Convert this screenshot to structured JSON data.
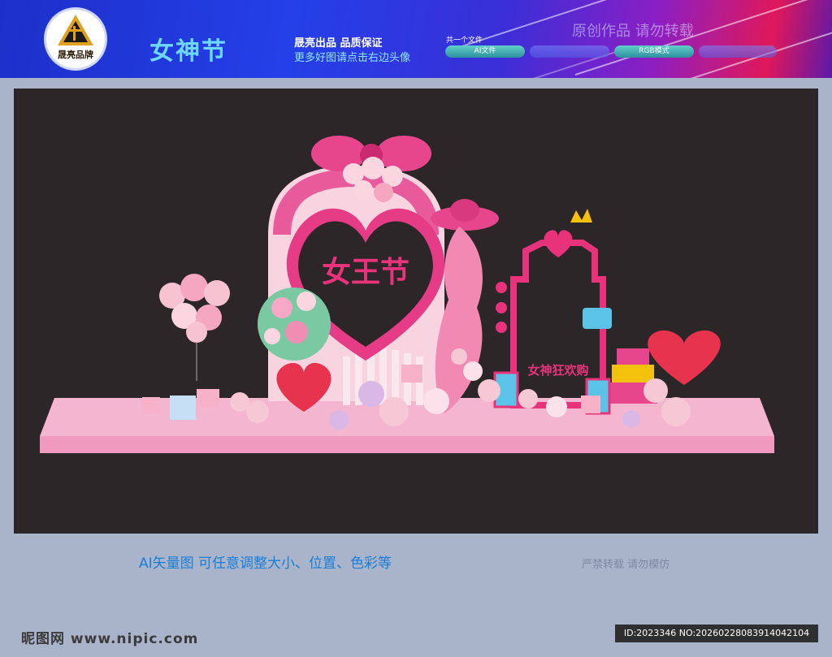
{
  "banner": {
    "logo_text": "晟亮品牌",
    "title": "女神节",
    "brand_line": "晟亮出品  品质保证",
    "sub_line": "更多好图请点击右边头像",
    "file_count": "共一个文件",
    "pill_ai": "AI文件",
    "pill_rgb": "RGB模式",
    "right_text": "原创作品  请勿转载"
  },
  "stage": {
    "heart_text": "女王节",
    "board_text": "女神狂欢购"
  },
  "caption": {
    "left": "AI矢量图  可任意调整大小、位置、色彩等",
    "right": "严禁转载  请勿模仿"
  },
  "footer": {
    "site": "昵图网 www.nipic.com",
    "id_text": "ID:2023346 NO:20260228083914042104"
  },
  "colors": {
    "banner_blue": "#2440e8",
    "accent_pink": "#e8337a",
    "stage_bg": "#2c2628",
    "platform": "#f2a8c6"
  }
}
